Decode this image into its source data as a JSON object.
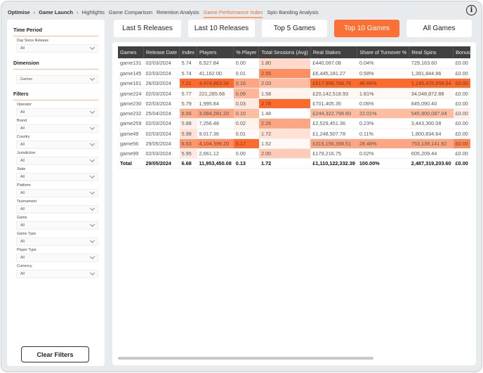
{
  "nav": {
    "breadcrumbs": [
      "Optimise",
      "Game Launch"
    ],
    "tabs": [
      {
        "label": "Highlights"
      },
      {
        "label": "Game Comparison"
      },
      {
        "label": "Retention Analysis"
      },
      {
        "label": "Game Performance Index",
        "active": true
      },
      {
        "label": "Spin Banding Analysis"
      }
    ],
    "info_icon": "info-icon",
    "info_glyph": "i"
  },
  "buttons": [
    {
      "label": "Last 5 Releases"
    },
    {
      "label": "Last 10 Releases"
    },
    {
      "label": "Top 5 Games"
    },
    {
      "label": "Top 10 Games",
      "active": true
    },
    {
      "label": "All Games"
    }
  ],
  "sidebar": {
    "sections": [
      {
        "title": "Time Period",
        "filters": [
          {
            "label": "Day Since Release",
            "value": "All"
          }
        ]
      },
      {
        "title": "Dimension",
        "filters": [
          {
            "label": "",
            "value": "Games"
          }
        ]
      },
      {
        "title": "Filters",
        "filters": [
          {
            "label": "Operator",
            "value": "All"
          },
          {
            "label": "Brand",
            "value": "All"
          },
          {
            "label": "Country",
            "value": "All"
          },
          {
            "label": "Jurisdiction",
            "value": "All"
          },
          {
            "label": "State",
            "value": "All"
          },
          {
            "label": "Platform",
            "value": "All"
          },
          {
            "label": "Tournament",
            "value": "All"
          },
          {
            "label": "Game",
            "value": "All"
          },
          {
            "label": "Game Type",
            "value": "All"
          },
          {
            "label": "Player Type",
            "value": "All"
          },
          {
            "label": "Currency",
            "value": "All"
          }
        ]
      }
    ],
    "clear_label": "Clear Filters"
  },
  "colors": {
    "accent": "#fd7035",
    "heat_max": "#fd6a2e",
    "heat_min": "#ffffff",
    "header_bg": "#404040"
  },
  "table": {
    "columns": [
      "Games",
      "Release Date",
      "Index",
      "Players",
      "% Player",
      "Total Sessions (Avg)",
      "Real Stakes",
      "Share of Turnover %",
      "Real Spins",
      "Bonus"
    ],
    "rows": [
      {
        "cells": [
          "game131",
          "02/03/2024",
          "5.74",
          "6,527.84",
          "0.00",
          "1.80",
          "£440,087.08",
          "0.04%",
          "729,163.60",
          "£0.00"
        ],
        "heat": [
          0,
          0,
          0,
          0,
          0,
          0.25,
          0,
          0,
          0,
          0
        ]
      },
      {
        "cells": [
          "game145",
          "02/03/2024",
          "5.74",
          "41,162.00",
          "0.01",
          "2.55",
          "£6,445,181.27",
          "0.58%",
          "1,391,844.96",
          "£0.00"
        ],
        "heat": [
          0,
          0,
          0,
          0,
          0,
          0.75,
          0.02,
          0.02,
          0.02,
          0
        ]
      },
      {
        "cells": [
          "game161",
          "26/03/2024",
          "7.21",
          "4,474,863.36",
          "0.16",
          "2.03",
          "£517,956,766.76",
          "46.66%",
          "1,145,415,658.64",
          "£0.00"
        ],
        "heat": [
          0,
          0,
          1,
          1,
          0.6,
          0.45,
          1,
          1,
          1,
          1
        ]
      },
      {
        "cells": [
          "game224",
          "02/03/2024",
          "5.77",
          "221,285.68",
          "0.09",
          "1.58",
          "£20,142,518.93",
          "1.81%",
          "34,048,872.88",
          "£0.00"
        ],
        "heat": [
          0,
          0,
          0.03,
          0.05,
          0.5,
          0.08,
          0.05,
          0.05,
          0.05,
          0
        ]
      },
      {
        "cells": [
          "game230",
          "02/03/2024",
          "5.79",
          "1,995.84",
          "0.03",
          "2.78",
          "£701,405.35",
          "0.06%",
          "845,090.40",
          "£0.00"
        ],
        "heat": [
          0,
          0,
          0.04,
          0,
          0.15,
          1,
          0,
          0,
          0,
          0
        ]
      },
      {
        "cells": [
          "game232",
          "25/04/2024",
          "6.56",
          "3,084,281.20",
          "0.10",
          "1.48",
          "£244,322,798.60",
          "22.01%",
          "545,900,087.04",
          "£0.00"
        ],
        "heat": [
          0,
          0,
          0.55,
          0.6,
          0.45,
          0,
          0.45,
          0.45,
          0.45,
          0.12
        ]
      },
      {
        "cells": [
          "game259",
          "02/03/2024",
          "5.88",
          "7,256.48",
          "0.02",
          "2.26",
          "£2,529,451.36",
          "0.23%",
          "3,443,300.08",
          "£0.00"
        ],
        "heat": [
          0,
          0,
          0.1,
          0,
          0.08,
          0.6,
          0,
          0,
          0,
          0
        ]
      },
      {
        "cells": [
          "game49",
          "02/03/2024",
          "5.98",
          "9,017.36",
          "0.01",
          "1.72",
          "£1,248,507.78",
          "0.11%",
          "1,800,834.64",
          "£0.00"
        ],
        "heat": [
          0,
          0,
          0.2,
          0,
          0.04,
          0.2,
          0,
          0,
          0,
          0
        ]
      },
      {
        "cells": [
          "game56",
          "29/05/2024",
          "6.53",
          "4,104,399.20",
          "0.17",
          "1.52",
          "£316,156,398.51",
          "28.48%",
          "753,139,141.92",
          "£0.00"
        ],
        "heat": [
          0,
          0,
          0.7,
          0.75,
          1,
          0.05,
          0.6,
          0.6,
          0.6,
          0.8
        ]
      },
      {
        "cells": [
          "game99",
          "02/03/2024",
          "5.95",
          "2,661.12",
          "0.00",
          "2.00",
          "£179,216.75",
          "0.02%",
          "605,209.44",
          "£0.00"
        ],
        "heat": [
          0,
          0,
          0.15,
          0,
          0,
          0.35,
          0,
          0,
          0,
          0
        ]
      }
    ],
    "total": [
      "Total",
      "29/05/2024",
      "6.68",
      "11,953,450.08",
      "0.13",
      "1.72",
      "£1,110,122,332.39",
      "100.00%",
      "2,487,319,203.60",
      "£0.00"
    ]
  }
}
